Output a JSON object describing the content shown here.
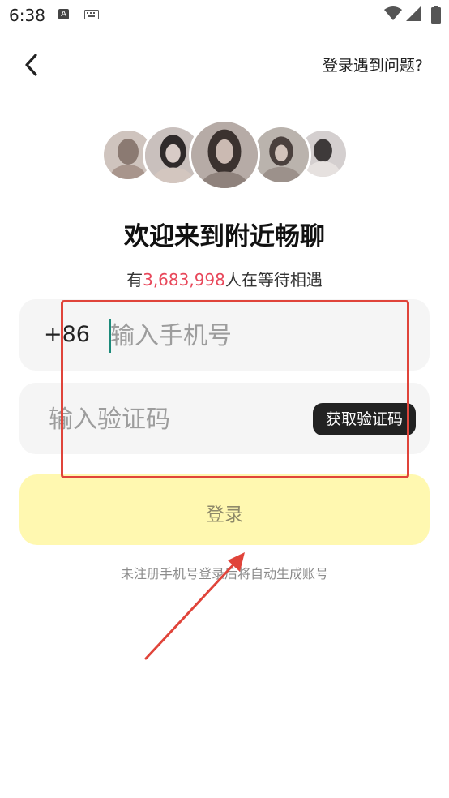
{
  "status_bar": {
    "time": "6:38",
    "icons": [
      "a-notification-icon",
      "keyboard-icon",
      "wifi-icon",
      "signal-icon",
      "battery-icon"
    ]
  },
  "header": {
    "back_icon": "chevron-left-icon",
    "help_link": "登录遇到问题?"
  },
  "welcome": {
    "title": "欢迎来到附近畅聊",
    "waiting_prefix": "有",
    "waiting_count": "3,683,998",
    "waiting_suffix": "人在等待相遇"
  },
  "form": {
    "country_code": "+86",
    "phone_placeholder": "输入手机号",
    "phone_value": "",
    "code_placeholder": "输入验证码",
    "code_value": "",
    "get_code_label": "获取验证码",
    "login_label": "登录",
    "footnote": "未注册手机号登录后将自动生成账号"
  },
  "colors": {
    "accent_count": "#e8475a",
    "login_bg": "#fff8b0",
    "annotation": "#e0443a",
    "caret": "#1c8a7a"
  },
  "annotations": {
    "highlight": "red-rectangle-around-inputs",
    "arrow": "red-arrow-pointing-to-login"
  }
}
